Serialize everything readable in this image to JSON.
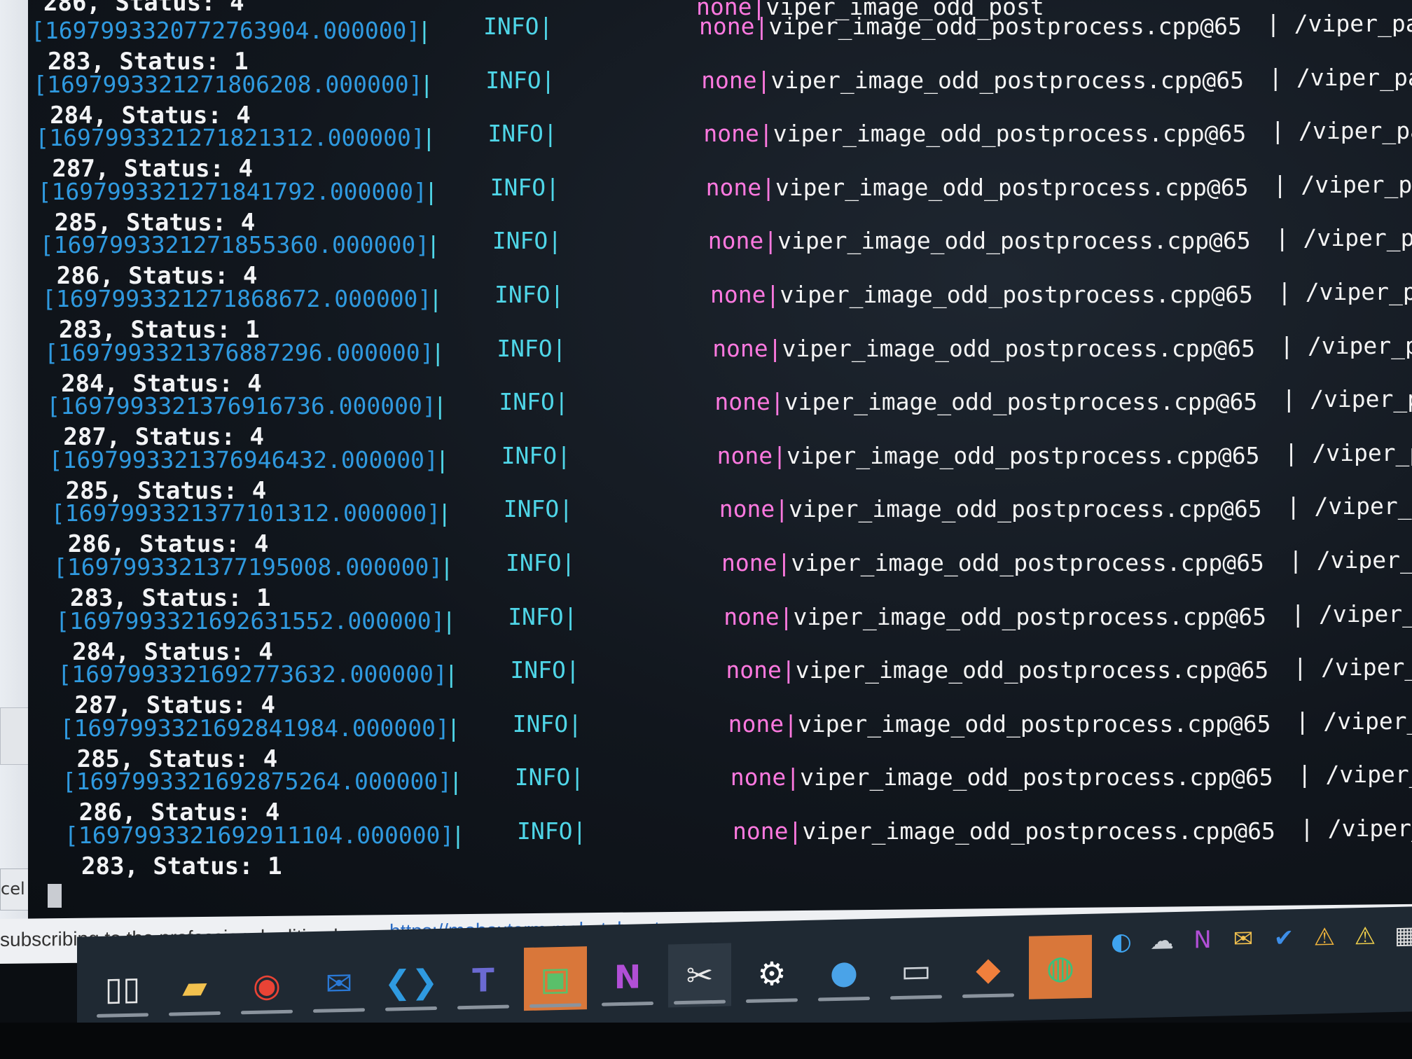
{
  "terminal": {
    "header_partial": {
      "status": "286, Status: 4",
      "msg_none": "none|",
      "msg_file": "viper_image_odd_post"
    },
    "rows": [
      {
        "ts": "[1697993320772763904.000000]",
        "msg_none": "none|",
        "msg_file": "viper_image_odd_postprocess.cpp@65",
        "path": "/viper_pa",
        "status_after": "283, Status: 1"
      },
      {
        "ts": "[1697993321271806208.000000]",
        "msg_none": "none|",
        "msg_file": "viper_image_odd_postprocess.cpp@65",
        "path": "/viper_pa",
        "status_after": "284, Status: 4"
      },
      {
        "ts": "[1697993321271821312.000000]",
        "msg_none": "none|",
        "msg_file": "viper_image_odd_postprocess.cpp@65",
        "path": "/viper_pa",
        "status_after": "287, Status: 4"
      },
      {
        "ts": "[1697993321271841792.000000]",
        "msg_none": "none|",
        "msg_file": "viper_image_odd_postprocess.cpp@65",
        "path": "/viper_pa",
        "status_after": "285, Status: 4"
      },
      {
        "ts": "[1697993321271855360.000000]",
        "msg_none": "none|",
        "msg_file": "viper_image_odd_postprocess.cpp@65",
        "path": "/viper_pa",
        "status_after": "286, Status: 4"
      },
      {
        "ts": "[1697993321271868672.000000]",
        "msg_none": "none|",
        "msg_file": "viper_image_odd_postprocess.cpp@65",
        "path": "/viper_pa",
        "status_after": "283, Status: 1"
      },
      {
        "ts": "[1697993321376887296.000000]",
        "msg_none": "none|",
        "msg_file": "viper_image_odd_postprocess.cpp@65",
        "path": "/viper_p",
        "status_after": "284, Status: 4"
      },
      {
        "ts": "[1697993321376916736.000000]",
        "msg_none": "none|",
        "msg_file": "viper_image_odd_postprocess.cpp@65",
        "path": "/viper_p",
        "status_after": "287, Status: 4"
      },
      {
        "ts": "[1697993321376946432.000000]",
        "msg_none": "none|",
        "msg_file": "viper_image_odd_postprocess.cpp@65",
        "path": "/viper_p",
        "status_after": "285, Status: 4"
      },
      {
        "ts": "[1697993321377101312.000000]",
        "msg_none": "none|",
        "msg_file": "viper_image_odd_postprocess.cpp@65",
        "path": "/viper_p",
        "status_after": "286, Status: 4"
      },
      {
        "ts": "[1697993321377195008.000000]",
        "msg_none": "none|",
        "msg_file": "viper_image_odd_postprocess.cpp@65",
        "path": "/viper_p",
        "status_after": "283, Status: 1"
      },
      {
        "ts": "[1697993321692631552.000000]",
        "msg_none": "none|",
        "msg_file": "viper_image_odd_postprocess.cpp@65",
        "path": "/viper_p",
        "status_after": "284, Status: 4"
      },
      {
        "ts": "[1697993321692773632.000000]",
        "msg_none": "none|",
        "msg_file": "viper_image_odd_postprocess.cpp@65",
        "path": "/viper_",
        "status_after": "287, Status: 4"
      },
      {
        "ts": "[1697993321692841984.000000]",
        "msg_none": "none|",
        "msg_file": "viper_image_odd_postprocess.cpp@65",
        "path": "/viper_",
        "status_after": "285, Status: 4"
      },
      {
        "ts": "[1697993321692875264.000000]",
        "msg_none": "none|",
        "msg_file": "viper_image_odd_postprocess.cpp@65",
        "path": "/viper_",
        "status_after": "286, Status: 4"
      },
      {
        "ts": "[1697993321692911104.000000]",
        "msg_none": "none|",
        "msg_file": "viper_image_odd_postprocess.cpp@65",
        "path": "/viper_",
        "status_after": "283, Status: 1"
      }
    ],
    "level": "INFO|",
    "pipe": "|"
  },
  "side_panel": {
    "chevron": "›",
    "cancel_label": "cel"
  },
  "banner": {
    "text": "subscribing to the professional edition here:",
    "link": "https://mobaxterm.mobatek.net"
  },
  "taskbar": {
    "items": [
      "task-view-icon",
      "file-explorer-icon",
      "chrome-icon",
      "outlook-icon",
      "vscode-icon",
      "teams-icon",
      "remote-desktop-icon",
      "onenote-icon",
      "snipping-tool-icon",
      "settings-icon",
      "app-circle-icon",
      "terminal-icon",
      "git-icon",
      "mobaxterm-icon"
    ],
    "tray": [
      "edge-icon",
      "onedrive-icon",
      "onenote-tray-icon",
      "mail-icon",
      "defender-icon",
      "network-warning-icon",
      "tray-warning-icon",
      "tray-overflow-icon"
    ]
  },
  "colors": {
    "timestamp": "#2f9ae0",
    "info": "#4fd6e8",
    "none": "#ff79e0",
    "status": "#f2f3f5"
  }
}
